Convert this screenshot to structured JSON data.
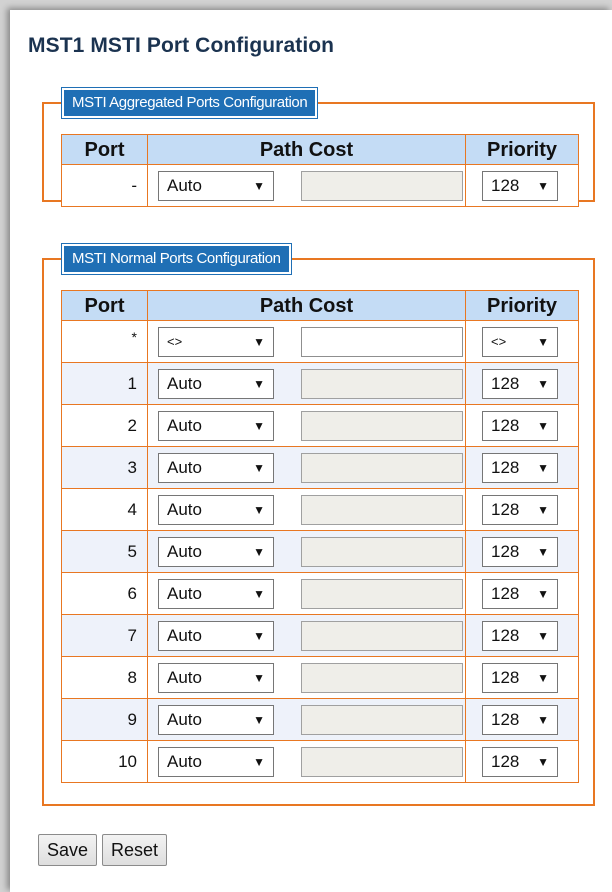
{
  "title": "MST1 MSTI Port Configuration",
  "aggregated": {
    "legend": "MSTI Aggregated Ports Configuration",
    "headers": {
      "port": "Port",
      "path_cost": "Path Cost",
      "priority": "Priority"
    },
    "rows": [
      {
        "port": "-",
        "path_cost_mode": "Auto",
        "path_cost_value": "",
        "priority": "128"
      }
    ]
  },
  "normal": {
    "legend": "MSTI Normal Ports Configuration",
    "headers": {
      "port": "Port",
      "path_cost": "Path Cost",
      "priority": "Priority"
    },
    "rows": [
      {
        "port": "*",
        "path_cost_mode": "<>",
        "path_cost_value": "",
        "priority": "<>"
      },
      {
        "port": "1",
        "path_cost_mode": "Auto",
        "path_cost_value": "",
        "priority": "128"
      },
      {
        "port": "2",
        "path_cost_mode": "Auto",
        "path_cost_value": "",
        "priority": "128"
      },
      {
        "port": "3",
        "path_cost_mode": "Auto",
        "path_cost_value": "",
        "priority": "128"
      },
      {
        "port": "4",
        "path_cost_mode": "Auto",
        "path_cost_value": "",
        "priority": "128"
      },
      {
        "port": "5",
        "path_cost_mode": "Auto",
        "path_cost_value": "",
        "priority": "128"
      },
      {
        "port": "6",
        "path_cost_mode": "Auto",
        "path_cost_value": "",
        "priority": "128"
      },
      {
        "port": "7",
        "path_cost_mode": "Auto",
        "path_cost_value": "",
        "priority": "128"
      },
      {
        "port": "8",
        "path_cost_mode": "Auto",
        "path_cost_value": "",
        "priority": "128"
      },
      {
        "port": "9",
        "path_cost_mode": "Auto",
        "path_cost_value": "",
        "priority": "128"
      },
      {
        "port": "10",
        "path_cost_mode": "Auto",
        "path_cost_value": "",
        "priority": "128"
      }
    ]
  },
  "buttons": {
    "save": "Save",
    "reset": "Reset"
  },
  "icons": {
    "dropdown": "triangle-down-icon"
  },
  "colors": {
    "title": "#1b3350",
    "legend_bg": "#1f6fb5",
    "border": "#e87722",
    "header_bg": "#c4dcf5",
    "row_alt_bg": "#eef2fa",
    "disabled_input_bg": "#efeee9"
  }
}
